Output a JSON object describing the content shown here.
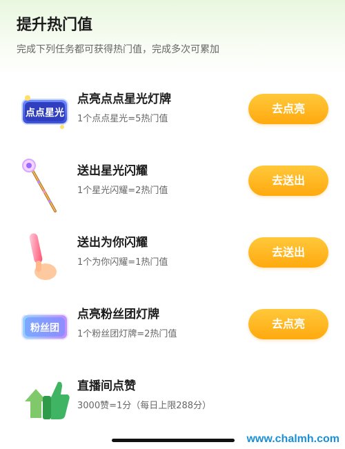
{
  "header": {
    "title": "提升热门值",
    "subtitle": "完成下列任务都可获得热门值，完成多次可累加"
  },
  "tasks": [
    {
      "name": "点亮点点星光灯牌",
      "desc": "1个点点星光=5热门值",
      "button": "去点亮",
      "icon": "star-light-badge-icon",
      "badge_text": "点点星光"
    },
    {
      "name": "送出星光闪耀",
      "desc": "1个星光闪耀=2热门值",
      "button": "去送出",
      "icon": "magic-wand-icon"
    },
    {
      "name": "送出为你闪耀",
      "desc": "1个为你闪耀=1热门值",
      "button": "去送出",
      "icon": "glow-stick-hand-icon"
    },
    {
      "name": "点亮粉丝团灯牌",
      "desc": "1个粉丝团灯牌=2热门值",
      "button": "去点亮",
      "icon": "fan-club-badge-icon",
      "badge_text": "粉丝团"
    },
    {
      "name": "直播间点赞",
      "desc": "3000赞=1分（每日上限288分）",
      "icon": "thumbs-up-icon"
    }
  ],
  "watermark": "www.chalmh.com",
  "colors": {
    "button": "#ffb020",
    "accent_green": "#4caf50"
  }
}
